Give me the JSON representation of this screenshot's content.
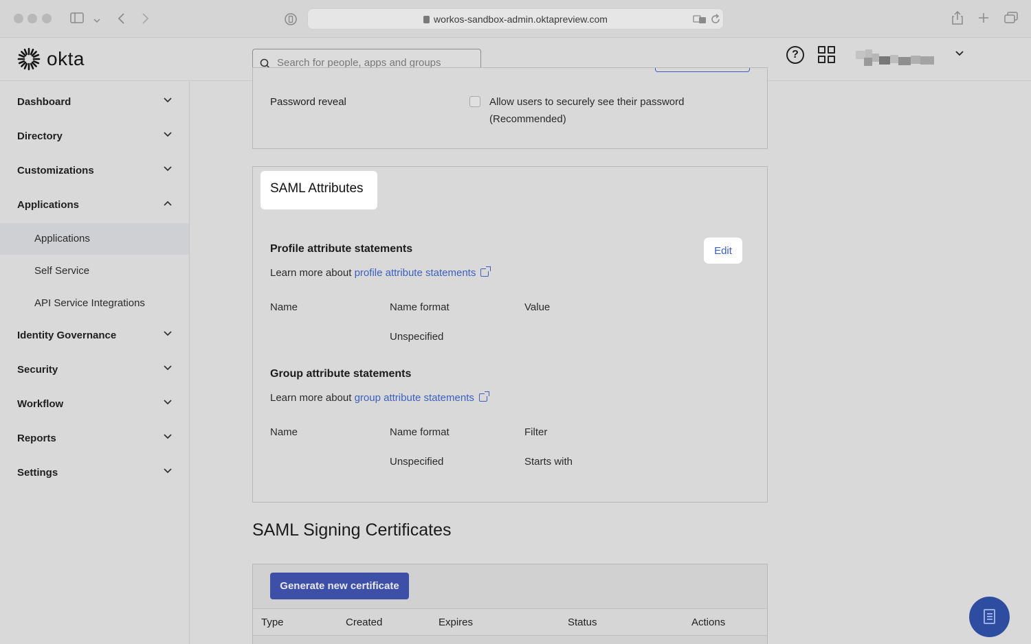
{
  "browser": {
    "url": "workos-sandbox-admin.oktapreview.com"
  },
  "header": {
    "logo_text": "okta",
    "search_placeholder": "Search for people, apps and groups"
  },
  "sidebar": {
    "items": [
      {
        "label": "Dashboard",
        "expanded": false
      },
      {
        "label": "Directory",
        "expanded": false
      },
      {
        "label": "Customizations",
        "expanded": false
      },
      {
        "label": "Applications",
        "expanded": true
      },
      {
        "label": "Identity Governance",
        "expanded": false
      },
      {
        "label": "Security",
        "expanded": false
      },
      {
        "label": "Workflow",
        "expanded": false
      },
      {
        "label": "Reports",
        "expanded": false
      },
      {
        "label": "Settings",
        "expanded": false
      }
    ],
    "applications_subitems": [
      {
        "label": "Applications",
        "active": true
      },
      {
        "label": "Self Service",
        "active": false
      },
      {
        "label": "API Service Integrations",
        "active": false
      }
    ]
  },
  "password_reveal": {
    "label": "Password reveal",
    "option_line1": "Allow users to securely see their password",
    "option_line2": "(Recommended)"
  },
  "saml_attributes": {
    "title": "SAML Attributes",
    "edit_label": "Edit",
    "profile": {
      "heading": "Profile attribute statements",
      "learn_prefix": "Learn more about",
      "learn_link": "profile attribute statements",
      "columns": [
        "Name",
        "Name format",
        "Value"
      ],
      "row": {
        "name": "",
        "format": "Unspecified",
        "value": ""
      }
    },
    "group": {
      "heading": "Group attribute statements",
      "learn_prefix": "Learn more about",
      "learn_link": "group attribute statements",
      "columns": [
        "Name",
        "Name format",
        "Filter"
      ],
      "row": {
        "name": "",
        "format": "Unspecified",
        "filter": "Starts with"
      }
    }
  },
  "signing_certificates": {
    "title": "SAML Signing Certificates",
    "generate_label": "Generate new certificate",
    "columns": [
      "Type",
      "Created",
      "Expires",
      "Status",
      "Actions"
    ]
  },
  "colors": {
    "link": "#3b5fc0",
    "primary_button": "#3e4fa8",
    "fab": "#2f4da0"
  }
}
